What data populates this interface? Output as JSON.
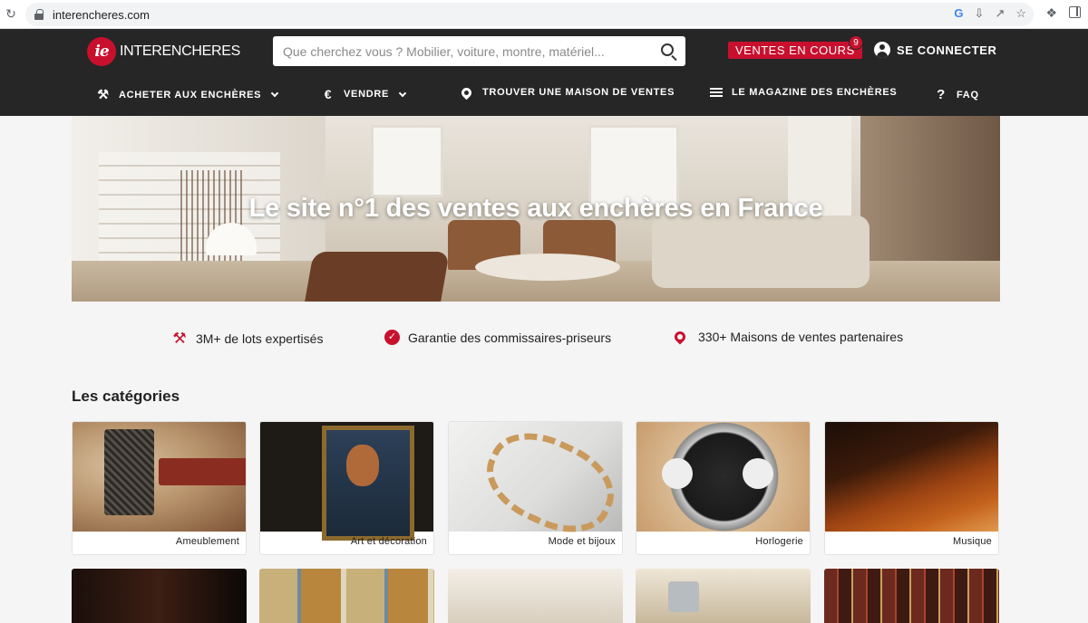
{
  "browser": {
    "url": "interencheres.com"
  },
  "header": {
    "logo_mark": "ie",
    "logo_text": "INTERENCHERES",
    "search_placeholder": "Que cherchez vous ? Mobilier, voiture, montre, matériel...",
    "ventes_label": "VENTES EN COURS",
    "ventes_count": "9",
    "login_label": "SE CONNECTER"
  },
  "nav": {
    "items": [
      {
        "label": "ACHETER AUX ENCHÈRES",
        "icon": "gavel-icon",
        "dropdown": true
      },
      {
        "label": "VENDRE",
        "icon": "euro-icon",
        "dropdown": true
      },
      {
        "label": "TROUVER UNE MAISON DE VENTES",
        "icon": "location-pin-icon",
        "dropdown": false
      },
      {
        "label": "LE MAGAZINE DES ENCHÈRES",
        "icon": "menu-icon",
        "dropdown": false
      },
      {
        "label": "FAQ",
        "icon": "question-icon",
        "dropdown": false
      }
    ]
  },
  "hero": {
    "title": "Le site n°1 des ventes aux enchères en France"
  },
  "features": [
    {
      "text": "3M+ de lots expertisés",
      "icon": "gavel-icon"
    },
    {
      "text": "Garantie des commissaires-priseurs",
      "icon": "verified-badge-icon"
    },
    {
      "text": "330+ Maisons de ventes partenaires",
      "icon": "location-pin-icon"
    }
  ],
  "categories": {
    "title": "Les catégories",
    "items": [
      {
        "label": "Ameublement"
      },
      {
        "label": "Art et décoration"
      },
      {
        "label": "Mode et bijoux"
      },
      {
        "label": "Horlogerie"
      },
      {
        "label": "Musique"
      }
    ]
  },
  "colors": {
    "brand_red": "#c8102e",
    "header_bg": "#262626",
    "page_bg": "#f5f5f5"
  }
}
